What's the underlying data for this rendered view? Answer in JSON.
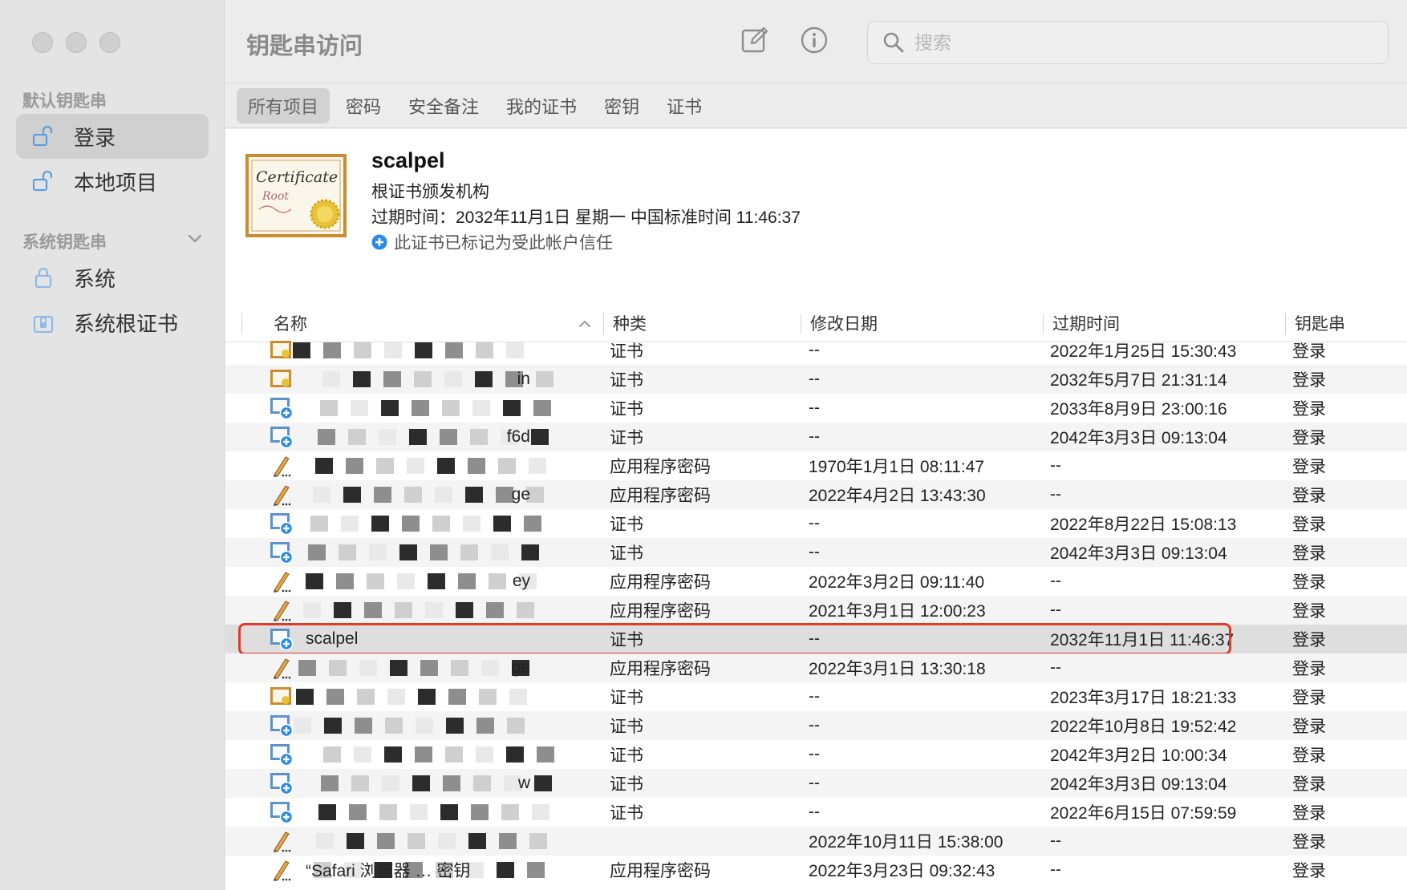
{
  "window": {
    "title": "钥匙串访问",
    "search_placeholder": "搜索",
    "toolbar_icons": [
      "compose-icon",
      "info-icon"
    ]
  },
  "sidebar": {
    "default_section": "默认钥匙串",
    "default_items": [
      {
        "label": "登录",
        "icon": "unlocked-icon",
        "active": true
      },
      {
        "label": "本地项目",
        "icon": "unlocked-icon",
        "active": false
      }
    ],
    "system_section": "系统钥匙串",
    "system_items": [
      {
        "label": "系统",
        "icon": "locked-icon"
      },
      {
        "label": "系统根证书",
        "icon": "locked-cabinet-icon"
      }
    ]
  },
  "tabs": [
    "所有项目",
    "密码",
    "安全备注",
    "我的证书",
    "密钥",
    "证书"
  ],
  "active_tab": "所有项目",
  "detail": {
    "name": "scalpel",
    "subtitle": "根证书颁发机构",
    "expiry": "过期时间：2032年11月1日 星期一 中国标准时间 11:46:37",
    "trust": "此证书已标记为受此帐户信任"
  },
  "columns": {
    "name": "名称",
    "kind": "种类",
    "modified": "修改日期",
    "expires": "过期时间",
    "keychain": "钥匙串"
  },
  "rows": [
    {
      "icon": "cert-icon",
      "name": "",
      "kind": "证书",
      "modified": "--",
      "expires": "2022年1月25日 15:30:43",
      "keychain": "登录"
    },
    {
      "icon": "cert-icon",
      "name": "in",
      "kind": "证书",
      "modified": "--",
      "expires": "2032年5月7日 21:31:14",
      "keychain": "登录"
    },
    {
      "icon": "cert-plus-icon",
      "name": "",
      "kind": "证书",
      "modified": "--",
      "expires": "2033年8月9日 23:00:16",
      "keychain": "登录"
    },
    {
      "icon": "cert-plus-icon",
      "name": "f6d",
      "kind": "证书",
      "modified": "--",
      "expires": "2042年3月3日 09:13:04",
      "keychain": "登录"
    },
    {
      "icon": "pencil-icon",
      "name": "",
      "kind": "应用程序密码",
      "modified": "1970年1月1日 08:11:47",
      "expires": "--",
      "keychain": "登录"
    },
    {
      "icon": "pencil-icon",
      "name": "ge",
      "kind": "应用程序密码",
      "modified": "2022年4月2日 13:43:30",
      "expires": "--",
      "keychain": "登录"
    },
    {
      "icon": "cert-plus-icon",
      "name": "",
      "kind": "证书",
      "modified": "--",
      "expires": "2022年8月22日 15:08:13",
      "keychain": "登录"
    },
    {
      "icon": "cert-plus-icon",
      "name": "",
      "kind": "证书",
      "modified": "--",
      "expires": "2042年3月3日 09:13:04",
      "keychain": "登录"
    },
    {
      "icon": "pencil-icon",
      "name": "ey",
      "kind": "应用程序密码",
      "modified": "2022年3月2日 09:11:40",
      "expires": "--",
      "keychain": "登录"
    },
    {
      "icon": "pencil-icon",
      "name": "",
      "kind": "应用程序密码",
      "modified": "2021年3月1日 12:00:23",
      "expires": "--",
      "keychain": "登录"
    },
    {
      "icon": "cert-plus-icon",
      "name": "scalpel",
      "kind": "证书",
      "modified": "--",
      "expires": "2032年11月1日 11:46:37",
      "keychain": "登录",
      "selected": true
    },
    {
      "icon": "pencil-icon",
      "name": "ge",
      "kind": "应用程序密码",
      "modified": "2022年3月1日 13:30:18",
      "expires": "--",
      "keychain": "登录"
    },
    {
      "icon": "cert-icon",
      "name": "",
      "kind": "证书",
      "modified": "--",
      "expires": "2023年3月17日 18:21:33",
      "keychain": "登录"
    },
    {
      "icon": "cert-plus-icon",
      "name": "",
      "kind": "证书",
      "modified": "--",
      "expires": "2022年10月8日 19:52:42",
      "keychain": "登录"
    },
    {
      "icon": "cert-plus-icon",
      "name": "",
      "kind": "证书",
      "modified": "--",
      "expires": "2042年3月2日 10:00:34",
      "keychain": "登录"
    },
    {
      "icon": "cert-plus-icon",
      "name": "w",
      "kind": "证书",
      "modified": "--",
      "expires": "2042年3月3日 09:13:04",
      "keychain": "登录"
    },
    {
      "icon": "cert-plus-icon",
      "name": "",
      "kind": "证书",
      "modified": "--",
      "expires": "2022年6月15日 07:59:59",
      "keychain": "登录"
    },
    {
      "icon": "pencil-icon",
      "name": "",
      "kind": "",
      "modified": "2022年10月11日 15:38:00",
      "expires": "--",
      "keychain": "登录"
    },
    {
      "icon": "pencil-icon",
      "name": "“Safari 浏览器 … 密钥",
      "kind": "应用程序密码",
      "modified": "2022年3月23日 09:32:43",
      "expires": "--",
      "keychain": "登录"
    }
  ],
  "colors": {
    "selection_outline": "#e03a2a",
    "trust_blue": "#2b8ae6"
  }
}
